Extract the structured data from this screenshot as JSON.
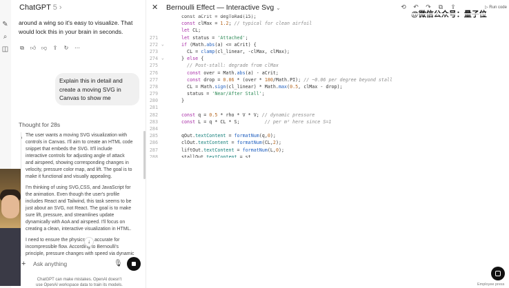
{
  "sidebar": {
    "icons": [
      "edit-icon",
      "search-icon",
      "library-icon"
    ]
  },
  "chat": {
    "title": "ChatGPT",
    "version": "5",
    "assistant_intro": [
      "around a wing so it's easy to visualize. That",
      "would lock this in your brain in seconds."
    ],
    "user_message": [
      "Explain this in detail and",
      "create a moving SVG in",
      "Canvas to show me"
    ],
    "thought_label": "Thought for 28s",
    "reasoning": [
      [
        "The user wants a moving SVG visualization with",
        "controls in Canvas. I'll aim to create an HTML code",
        "snippet that embeds the SVG. It'll include",
        "interactive controls for adjusting angle of attack",
        "and airspeed, showing corresponding changes in",
        "velocity, pressure color map, and lift. The goal is to",
        "make it functional and visually appealing."
      ],
      [
        "I'm thinking of using SVG,CSS, and JavaScript for",
        "the animation. Even though the user's profile",
        "includes React and Tailwind, this task seems to be",
        "just about an SVG, not React. The goal is to make",
        "sure lift, pressure, and streamlines update",
        "dynamically with AoA and airspeed. I'll focus on",
        "creating a clean, interactive visualization in HTML."
      ],
      [
        "I need to ensure the physics are accurate for",
        "incompressible flow. According to Bernoulli's",
        "principle, pressure changes with speed via dynamic"
      ]
    ],
    "composer_placeholder": "Ask anything",
    "disclaimer": [
      "ChatGPT can make mistakes. OpenAI doesn't",
      "use OpenAI workspace data to train its models."
    ]
  },
  "canvas": {
    "doc_title": "Bernoulli Effect — Interactive Svg",
    "run_code_label": "Run code",
    "watermark": "@微信公众号：量子位",
    "employee_label": "Employee press",
    "code_lines": [
      {
        "n": "",
        "fold": false,
        "tokens": [
          [
            "p",
            "const aCrit = degToRad(15);"
          ]
        ]
      },
      {
        "n": "",
        "fold": false,
        "tokens": [
          [
            "k",
            "const"
          ],
          [
            "p",
            " clMax = "
          ],
          [
            "n",
            "1.2"
          ],
          [
            "p",
            "; "
          ],
          [
            "c",
            "// typical for clean airfoil"
          ]
        ]
      },
      {
        "n": "",
        "fold": false,
        "tokens": [
          [
            "k",
            "let"
          ],
          [
            "p",
            " CL;"
          ]
        ]
      },
      {
        "n": "271",
        "fold": false,
        "tokens": [
          [
            "k",
            "let"
          ],
          [
            "p",
            " status = "
          ],
          [
            "s",
            "'Attached'"
          ],
          [
            "p",
            ";"
          ]
        ]
      },
      {
        "n": "272",
        "fold": true,
        "tokens": [
          [
            "k",
            "if"
          ],
          [
            "p",
            " (Math."
          ],
          [
            "f",
            "abs"
          ],
          [
            "p",
            "(a) <= aCrit) {"
          ]
        ]
      },
      {
        "n": "273",
        "fold": false,
        "tokens": [
          [
            "p",
            "  CL = "
          ],
          [
            "f",
            "clamp"
          ],
          [
            "p",
            "(cl_linear, -clMax, clMax);"
          ]
        ]
      },
      {
        "n": "274",
        "fold": true,
        "tokens": [
          [
            "p",
            "} "
          ],
          [
            "k",
            "else"
          ],
          [
            "p",
            " {"
          ]
        ]
      },
      {
        "n": "275",
        "fold": false,
        "tokens": [
          [
            "c",
            "  // Post-stall: degrade from clMax"
          ]
        ]
      },
      {
        "n": "276",
        "fold": false,
        "tokens": [
          [
            "k",
            "  const"
          ],
          [
            "p",
            " over = Math."
          ],
          [
            "f",
            "abs"
          ],
          [
            "p",
            "(a) - aCrit;"
          ]
        ]
      },
      {
        "n": "277",
        "fold": false,
        "tokens": [
          [
            "k",
            "  const"
          ],
          [
            "p",
            " drop = "
          ],
          [
            "n",
            "0.06"
          ],
          [
            "p",
            " * (over * "
          ],
          [
            "n",
            "180"
          ],
          [
            "p",
            "/Math.PI); "
          ],
          [
            "c",
            "// ~0.06 per degree beyond stall"
          ]
        ]
      },
      {
        "n": "278",
        "fold": false,
        "tokens": [
          [
            "p",
            "  CL = Math."
          ],
          [
            "f",
            "sign"
          ],
          [
            "p",
            "(cl_linear) * Math."
          ],
          [
            "f",
            "max"
          ],
          [
            "p",
            "("
          ],
          [
            "n",
            "0.5"
          ],
          [
            "p",
            ", clMax - drop);"
          ]
        ]
      },
      {
        "n": "279",
        "fold": false,
        "tokens": [
          [
            "p",
            "  status = "
          ],
          [
            "s",
            "'Near/After Stall'"
          ],
          [
            "p",
            ";"
          ]
        ]
      },
      {
        "n": "280",
        "fold": false,
        "tokens": [
          [
            "p",
            "}"
          ]
        ]
      },
      {
        "n": "281",
        "fold": false,
        "tokens": [
          [
            "p",
            ""
          ]
        ]
      },
      {
        "n": "282",
        "fold": false,
        "tokens": [
          [
            "k",
            "const"
          ],
          [
            "p",
            " q = "
          ],
          [
            "n",
            "0.5"
          ],
          [
            "p",
            " * rho * V * V; "
          ],
          [
            "c",
            "// dynamic pressure"
          ]
        ]
      },
      {
        "n": "283",
        "fold": false,
        "tokens": [
          [
            "k",
            "const"
          ],
          [
            "p",
            " L = q * CL * S;         "
          ],
          [
            "c",
            "// per m² here since S=1"
          ]
        ]
      },
      {
        "n": "284",
        "fold": false,
        "tokens": [
          [
            "p",
            ""
          ]
        ]
      },
      {
        "n": "285",
        "fold": false,
        "tokens": [
          [
            "p",
            "qOut."
          ],
          [
            "r",
            "textContent"
          ],
          [
            "p",
            " = "
          ],
          [
            "f",
            "formatNum"
          ],
          [
            "p",
            "(q,"
          ],
          [
            "n",
            "0"
          ],
          [
            "p",
            ");"
          ]
        ]
      },
      {
        "n": "286",
        "fold": false,
        "tokens": [
          [
            "p",
            "clOut."
          ],
          [
            "r",
            "textContent"
          ],
          [
            "p",
            " = "
          ],
          [
            "f",
            "formatNum"
          ],
          [
            "p",
            "(CL,"
          ],
          [
            "n",
            "2"
          ],
          [
            "p",
            ");"
          ]
        ]
      },
      {
        "n": "287",
        "fold": false,
        "tokens": [
          [
            "p",
            "liftOut."
          ],
          [
            "r",
            "textContent"
          ],
          [
            "p",
            " = "
          ],
          [
            "f",
            "formatNum"
          ],
          [
            "p",
            "(L,"
          ],
          [
            "n",
            "0"
          ],
          [
            "p",
            ");"
          ]
        ]
      },
      {
        "n": "288",
        "fold": false,
        "tokens": [
          [
            "p",
            "stallOut."
          ],
          [
            "r",
            "textContent"
          ],
          [
            "p",
            " = st"
          ]
        ]
      }
    ]
  }
}
